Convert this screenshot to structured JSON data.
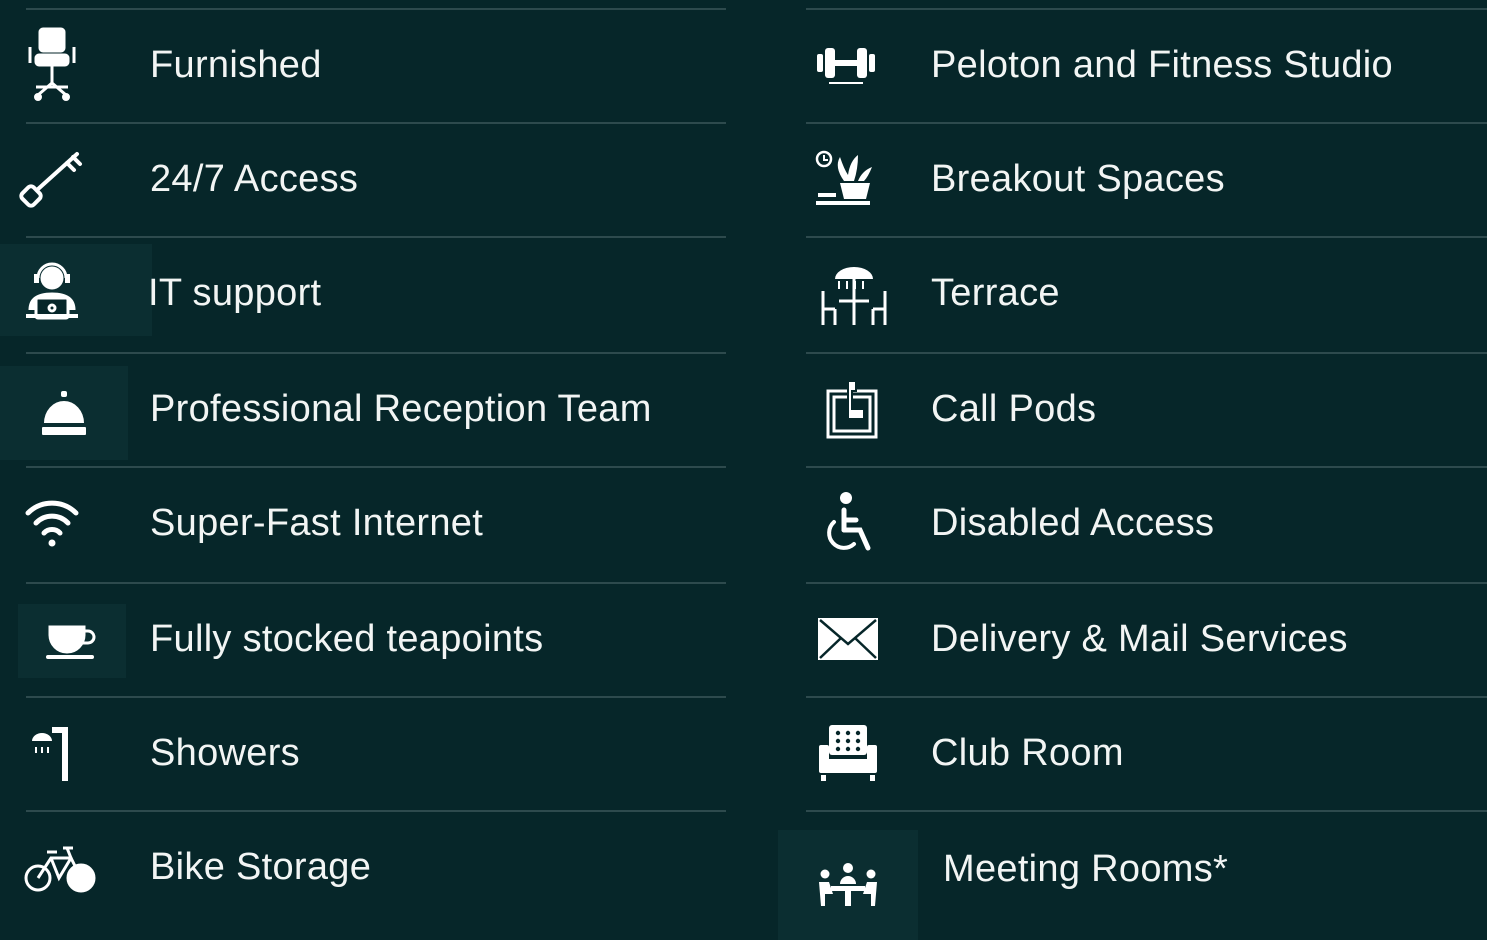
{
  "left_items": [
    {
      "label": "Furnished",
      "icon": "office-chair-icon"
    },
    {
      "label": "24/7 Access",
      "icon": "key-icon"
    },
    {
      "label": "IT support",
      "icon": "support-agent-icon"
    },
    {
      "label": "Professional Reception Team",
      "icon": "reception-bell-icon"
    },
    {
      "label": "Super-Fast Internet",
      "icon": "wifi-icon"
    },
    {
      "label": "Fully stocked teapoints",
      "icon": "teacup-icon"
    },
    {
      "label": "Showers",
      "icon": "shower-icon"
    },
    {
      "label": "Bike Storage",
      "icon": "bicycle-icon"
    }
  ],
  "right_items": [
    {
      "label": "Peloton and Fitness Studio",
      "icon": "dumbbell-icon"
    },
    {
      "label": "Breakout Spaces",
      "icon": "plant-icon"
    },
    {
      "label": "Terrace",
      "icon": "terrace-table-icon"
    },
    {
      "label": "Call Pods",
      "icon": "phone-booth-icon"
    },
    {
      "label": "Disabled Access",
      "icon": "wheelchair-icon"
    },
    {
      "label": "Delivery & Mail Services",
      "icon": "envelope-icon"
    },
    {
      "label": "Club Room",
      "icon": "armchair-icon"
    },
    {
      "label": "Meeting Rooms*",
      "icon": "meeting-group-icon"
    }
  ],
  "colors": {
    "background": "#062629",
    "divider": "#2d4a4d",
    "icon_highlight": "#0b2e31",
    "text": "#f2f5f4"
  }
}
